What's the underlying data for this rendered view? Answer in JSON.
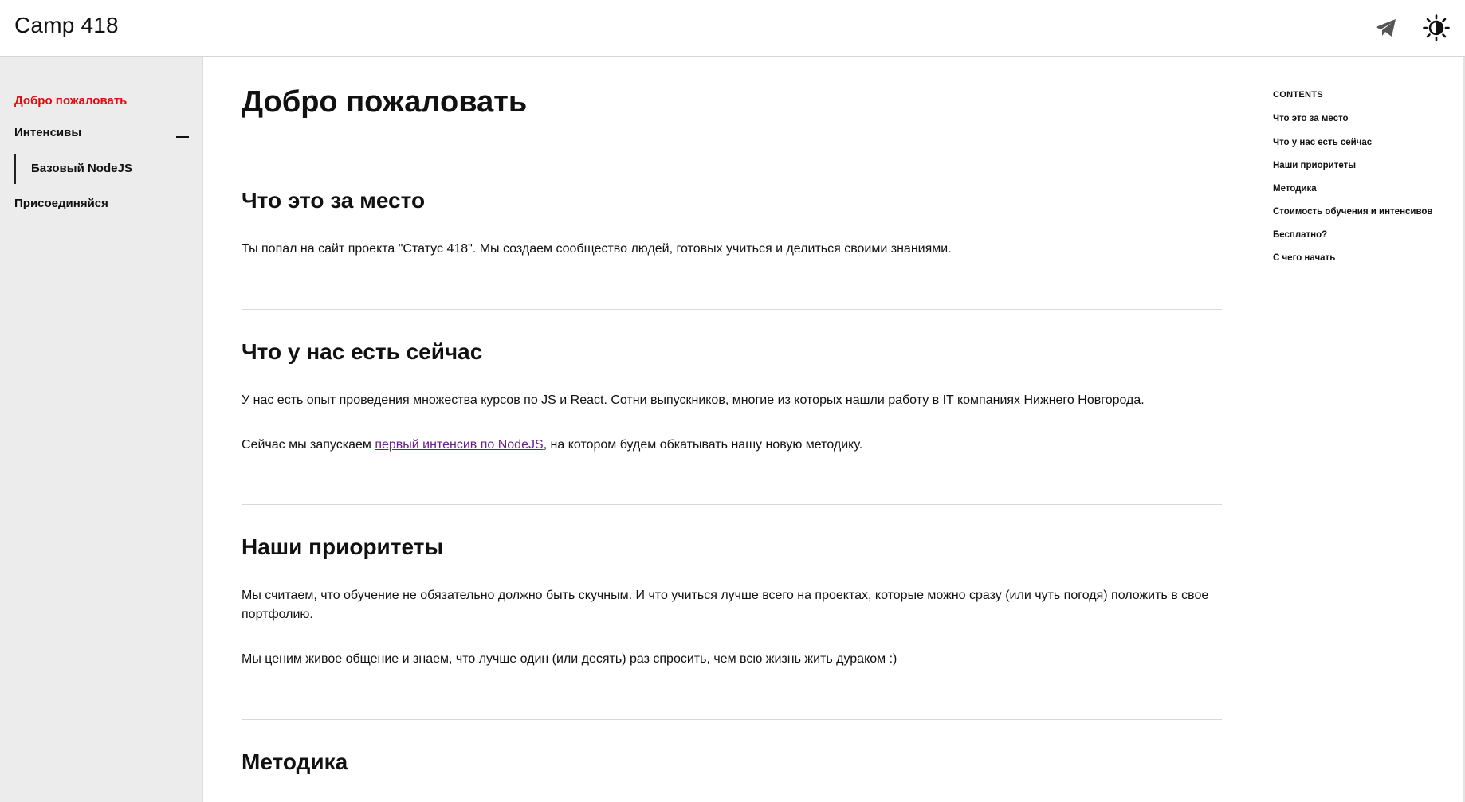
{
  "header": {
    "brand": "Camp 418",
    "icons": [
      "telegram-icon",
      "theme-toggle-icon"
    ]
  },
  "sidebar": {
    "items": [
      {
        "label": "Добро пожаловать",
        "active": true
      },
      {
        "label": "Интенсивы",
        "expanded": true,
        "children": [
          {
            "label": "Базовый NodeJS"
          }
        ]
      },
      {
        "label": "Присоединяйся"
      }
    ]
  },
  "main": {
    "title": "Добро пожаловать",
    "sections": [
      {
        "heading": "Что это за место",
        "paragraphs": [
          "Ты попал на сайт проекта \"Статус 418\". Мы создаем сообщество людей, готовых учиться и делиться своими знаниями."
        ]
      },
      {
        "heading": "Что у нас есть сейчас",
        "paragraphs": [
          "У нас есть опыт проведения множества курсов по JS и React. Сотни выпускников, многие из которых нашли работу в IT компаниях Нижнего Новгорода."
        ],
        "link_paragraph": {
          "before": "Сейчас мы запускаем ",
          "link": "первый интенсив по NodeJS",
          "after": ", на котором будем обкатывать нашу новую методику."
        }
      },
      {
        "heading": "Наши приоритеты",
        "paragraphs": [
          "Мы считаем, что обучение не обязательно должно быть скучным. И что учиться лучше всего на проектах, которые можно сразу (или чуть погодя) положить в свое портфолию.",
          "Мы ценим живое общение и знаем, что лучше один (или десять) раз спросить, чем всю жизнь жить дураком :)"
        ]
      },
      {
        "heading": "Методика",
        "paragraphs": []
      }
    ]
  },
  "toc": {
    "title": "CONTENTS",
    "items": [
      "Что это за место",
      "Что у нас есть сейчас",
      "Наши приоритеты",
      "Методика",
      "Стоимость обучения и интенсивов",
      "Бесплатно?",
      "С чего начать"
    ]
  },
  "colors": {
    "accent": "#e30b0b",
    "link": "#6b1d8a",
    "sidebar_bg": "#ececec"
  }
}
